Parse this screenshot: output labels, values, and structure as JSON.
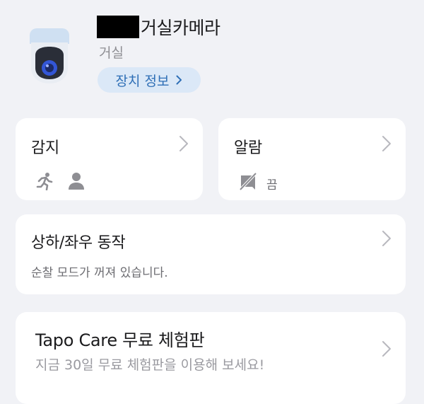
{
  "device": {
    "name": "거실카메라",
    "room": "거실",
    "info_button_label": "장치 정보",
    "icon": "camera-icon"
  },
  "detection": {
    "title": "감지",
    "icons": [
      "person-running-icon",
      "person-icon"
    ]
  },
  "alarm": {
    "title": "알람",
    "status": "끔",
    "icon": "alarm-off-icon"
  },
  "pan_tilt": {
    "title": "상하/좌우 동작",
    "status": "순찰 모드가 꺼져 있습니다."
  },
  "tapo_care": {
    "title": "Tapo Care 무료 체험판",
    "subtitle": "지금 30일 무료 체험판을 이용해 보세요!"
  },
  "colors": {
    "background": "#f1f2f6",
    "card": "#ffffff",
    "accent": "#2f6fb6",
    "accent_bg": "#dbe8f7",
    "camera_lens": "#3356d6"
  }
}
